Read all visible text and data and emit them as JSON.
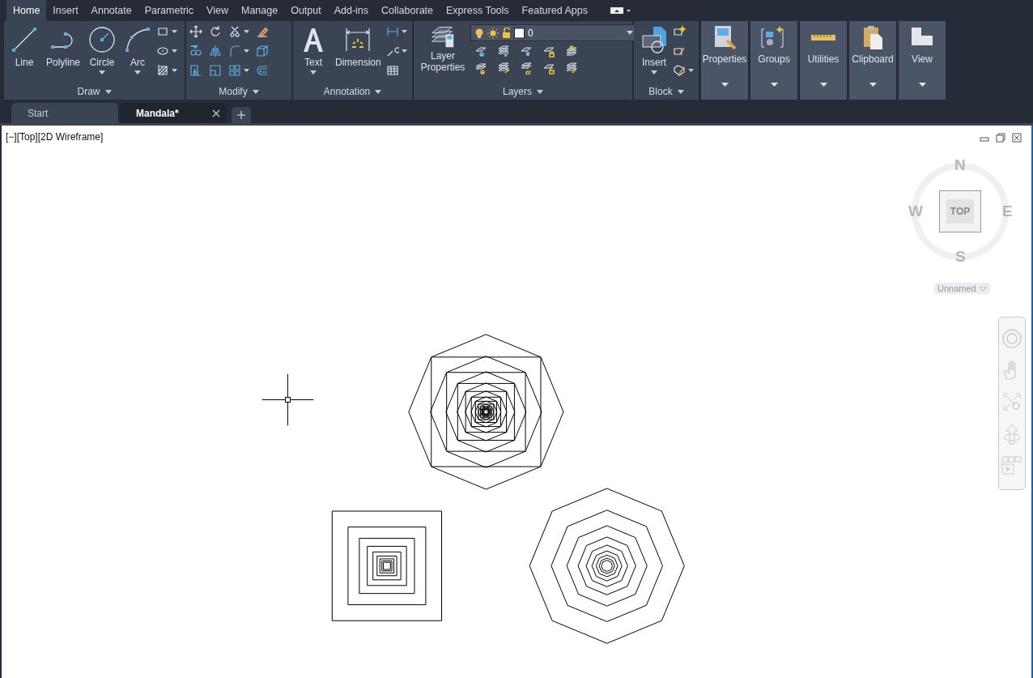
{
  "ribbon_tabs": [
    {
      "label": "Home",
      "selected": true
    },
    {
      "label": "Insert",
      "selected": false
    },
    {
      "label": "Annotate",
      "selected": false
    },
    {
      "label": "Parametric",
      "selected": false
    },
    {
      "label": "View",
      "selected": false
    },
    {
      "label": "Manage",
      "selected": false
    },
    {
      "label": "Output",
      "selected": false
    },
    {
      "label": "Add-ins",
      "selected": false
    },
    {
      "label": "Collaborate",
      "selected": false
    },
    {
      "label": "Express Tools",
      "selected": false
    },
    {
      "label": "Featured Apps",
      "selected": false
    }
  ],
  "panels": {
    "draw": {
      "title": "Draw",
      "tools": [
        {
          "kind": "line",
          "label": "Line",
          "dropdown": false
        },
        {
          "kind": "polyline",
          "label": "Polyline",
          "dropdown": false
        },
        {
          "kind": "circle",
          "label": "Circle",
          "dropdown": true
        },
        {
          "kind": "arc",
          "label": "Arc",
          "dropdown": true
        }
      ]
    },
    "modify": {
      "title": "Modify"
    },
    "annotation": {
      "title": "Annotation",
      "tools": [
        {
          "kind": "text",
          "label": "Text",
          "dropdown": true
        },
        {
          "kind": "dimension",
          "label": "Dimension",
          "dropdown": false
        }
      ]
    },
    "layers": {
      "title": "Layers",
      "tool": {
        "label": "Layer Properties"
      },
      "current_layer": "0"
    },
    "block": {
      "title": "Block",
      "tool": {
        "label": "Insert",
        "dropdown": true
      }
    },
    "collapsed": [
      {
        "kind": "properties",
        "title": "Properties"
      },
      {
        "kind": "groups",
        "title": "Groups"
      },
      {
        "kind": "utilities",
        "title": "Utilities"
      },
      {
        "kind": "clipboard",
        "title": "Clipboard"
      },
      {
        "kind": "view",
        "title": "View"
      }
    ]
  },
  "document_tabs": [
    {
      "label": "Start",
      "selected": false
    },
    {
      "label": "Mandala*",
      "selected": true
    }
  ],
  "viewport": {
    "label": "[−][Top][2D Wireframe]",
    "viewcube": {
      "north": "N",
      "south": "S",
      "east": "E",
      "west": "W",
      "face": "TOP",
      "coordinate_system": "Unnamed"
    }
  }
}
